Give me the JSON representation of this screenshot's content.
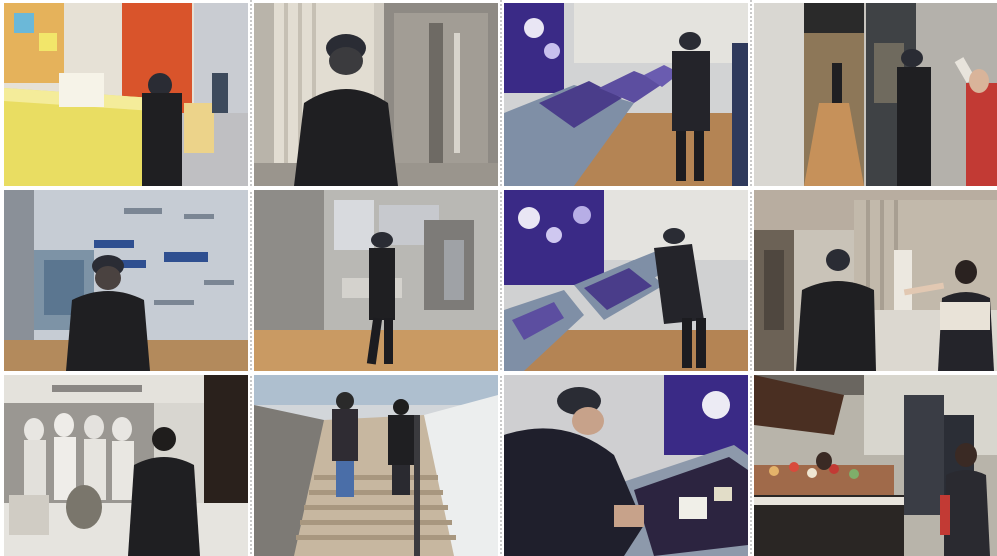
{
  "grid": {
    "columns": 4,
    "rows": 3,
    "photos": [
      {
        "row": 1,
        "col": 1,
        "scene": "reception-desk"
      },
      {
        "row": 1,
        "col": 2,
        "scene": "glass-door-lobby"
      },
      {
        "row": 1,
        "col": 3,
        "scene": "kiosk-row"
      },
      {
        "row": 1,
        "col": 4,
        "scene": "corridor-with-phone"
      },
      {
        "row": 2,
        "col": 1,
        "scene": "wall-exhibit-labels"
      },
      {
        "row": 2,
        "col": 2,
        "scene": "museum-gallery"
      },
      {
        "row": 2,
        "col": 3,
        "scene": "kiosk-touchscreen"
      },
      {
        "row": 2,
        "col": 4,
        "scene": "staff-explaining"
      },
      {
        "row": 3,
        "col": 1,
        "scene": "historic-photo-wall"
      },
      {
        "row": 3,
        "col": 2,
        "scene": "stairway-descent"
      },
      {
        "row": 3,
        "col": 3,
        "scene": "kiosk-closeup"
      },
      {
        "row": 3,
        "col": 4,
        "scene": "shop-counter"
      }
    ]
  },
  "colors": {
    "jacket": "#1f1f22",
    "cap": "#2a2c34",
    "floor_wood": "#b88a5a",
    "yellow_desk": "#e9dd62",
    "orange_wall": "#d9542b",
    "screen_purple": "#3a2a86",
    "kiosk_grey": "#7f8fa6",
    "wall_light": "#d7dbe0"
  }
}
